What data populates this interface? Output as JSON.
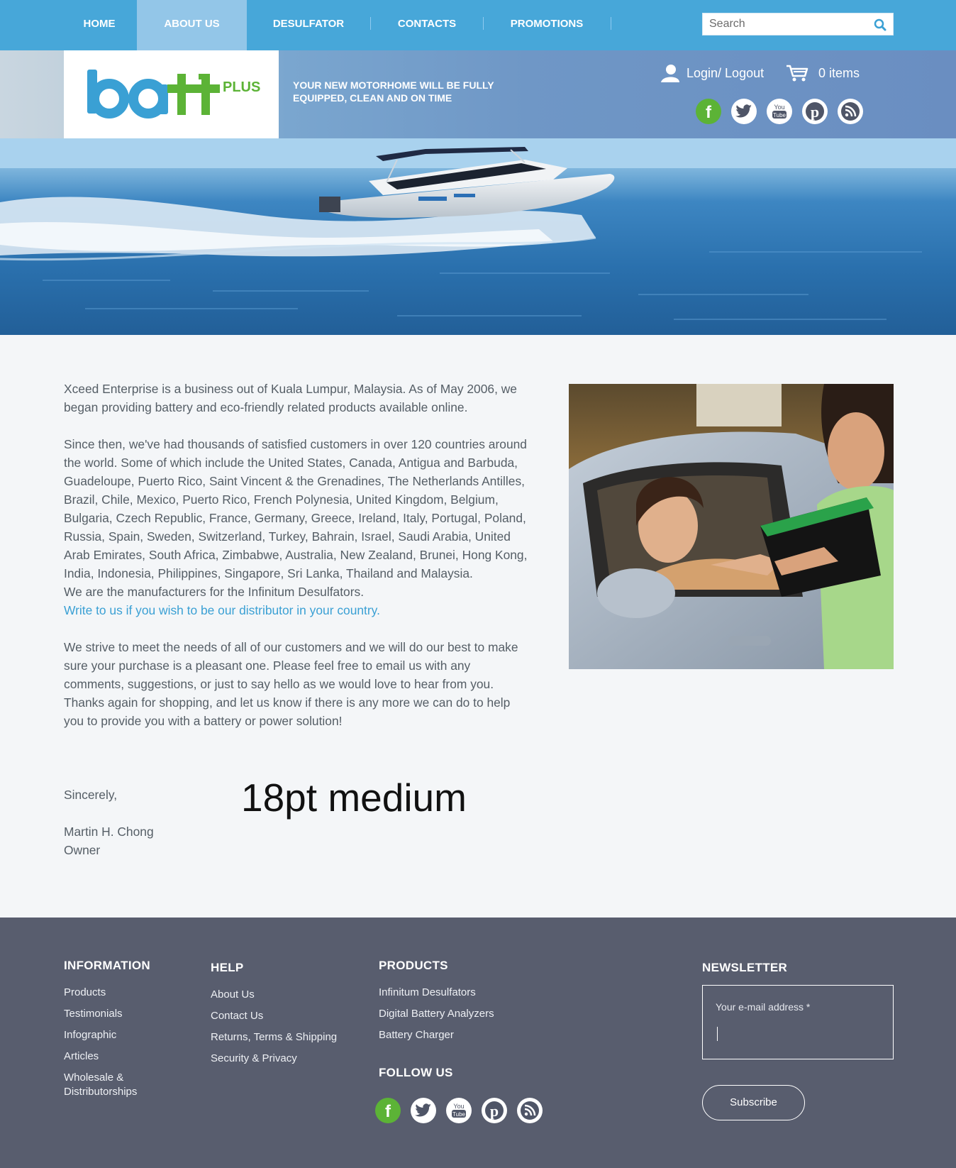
{
  "nav": {
    "items": [
      {
        "label": "HOME"
      },
      {
        "label": "ABOUT US"
      },
      {
        "label": "DESULFATOR"
      },
      {
        "label": "CONTACTS"
      },
      {
        "label": "PROMOTIONS"
      }
    ],
    "active_index": 1,
    "search_placeholder": "Search"
  },
  "header": {
    "logo_text": "ba",
    "logo_plus": "PLUS",
    "tagline": "YOUR NEW MOTORHOME WILL BE FULLY EQUIPPED, CLEAN AND ON TIME",
    "login_label": "Login/ Logout",
    "cart_label": "0 items",
    "social_icons": [
      "facebook-icon",
      "twitter-icon",
      "youtube-icon",
      "pinterest-icon",
      "rss-icon"
    ]
  },
  "content": {
    "para1": "Xceed Enterprise is a business out of Kuala Lumpur, Malaysia. As of May 2006, we began providing battery and eco-friendly related products available online.",
    "para2": "Since then, we've had thousands of satisfied customers in over 120 countries around the world. Some of which include the United States, Canada, Antigua and Barbuda, Guadeloupe, Puerto Rico, Saint Vincent & the Grenadines, The Netherlands Antilles, Brazil, Chile, Mexico, Puerto Rico, French Polynesia, United Kingdom, Belgium, Bulgaria, Czech Republic, France, Germany, Greece, Ireland, Italy, Portugal, Poland, Russia, Spain, Sweden, Switzerland, Turkey, Bahrain, Israel, Saudi Arabia, United Arab Emirates, South Africa, Zimbabwe, Australia, New Zealand, Brunei, Hong Kong, India, Indonesia, Philippines, Singapore, Sri Lanka, Thailand and Malaysia.",
    "para2_manufacturer": "We are the manufacturers for the Infinitum Desulfators.",
    "distributor_link": "Write to us if you wish to be our distributor in your country.",
    "para3": "We strive to meet the needs of all of our customers and we will do our best to make sure your purchase is a pleasant one. Please feel free to email us with any comments, suggestions, or just to say hello as we would love to hear from you. Thanks again for shopping, and let us know if there is any more we can do to help you to provide you with a battery or power solution!",
    "sincerely": "Sincerely,",
    "signer_name": "Martin H. Chong",
    "signer_title": "Owner",
    "annotation": "18pt medium"
  },
  "footer": {
    "information": {
      "heading": "INFORMATION",
      "links": [
        "Products",
        "Testimonials",
        "Infographic",
        "Articles",
        "Wholesale & Distributorships"
      ]
    },
    "help": {
      "heading": "HELP",
      "links": [
        "About Us",
        "Contact Us",
        "Returns, Terms & Shipping",
        "Security & Privacy"
      ]
    },
    "products": {
      "heading": "PRODUCTS",
      "links": [
        "Infinitum Desulfators",
        "Digital Battery Analyzers",
        "Battery Charger"
      ]
    },
    "follow": {
      "heading": "FOLLOW US"
    },
    "newsletter": {
      "heading": "NEWSLETTER",
      "email_placeholder": "Your e-mail address *",
      "subscribe_label": "Subscribe"
    }
  },
  "colors": {
    "nav_bg": "#47a7d9",
    "nav_active": "#93c6e8",
    "link": "#3aa0d4",
    "footer_bg": "#585d6e",
    "facebook": "#5cb336",
    "logo_blue": "#3aa0d4",
    "logo_green": "#5cb336"
  }
}
